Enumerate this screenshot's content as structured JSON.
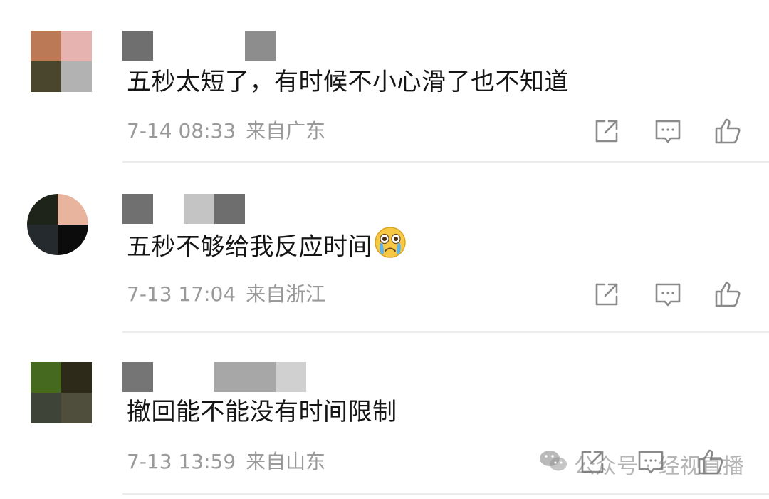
{
  "comments": [
    {
      "text": "五秒太短了，有时候不小心滑了也不知道",
      "date": "7-14 08:33",
      "location": "来自广东",
      "avatar_pixels": [
        "#bb7a55",
        "#e6b3b0",
        "#4a452d",
        "#b2b2b2"
      ],
      "name_blocks": [
        "#6f6f6f",
        "#8d8d8d"
      ]
    },
    {
      "text": "五秒不够给我反应时间",
      "emoji": "crying-face",
      "date": "7-13 17:04",
      "location": "来自浙江",
      "avatar_pixels": [
        "#1e2419",
        "#e8b49d",
        "#242a2e",
        "#0c0c0c"
      ],
      "name_blocks": [
        "#707070",
        "#c4c4c4",
        "#6e6e6e"
      ]
    },
    {
      "text": "撤回能不能没有时间限制",
      "date": "7-13 13:59",
      "location": "来自山东",
      "avatar_pixels": [
        "#456a1f",
        "#2d2a1a",
        "#3f4439",
        "#4f4d3b"
      ],
      "name_blocks": [
        "#757575",
        "#a7a7a7",
        "#d0d0d0"
      ]
    }
  ],
  "icons": {
    "share": "share-icon",
    "reply": "comment-icon",
    "like": "thumbs-up-icon"
  },
  "colors": {
    "text": "#151515",
    "meta": "#9a9a9a",
    "icon": "#8a8a8a",
    "divider": "#ececec"
  },
  "watermark": {
    "text": "公众号 · 经视直播",
    "icon": "wechat-icon"
  }
}
